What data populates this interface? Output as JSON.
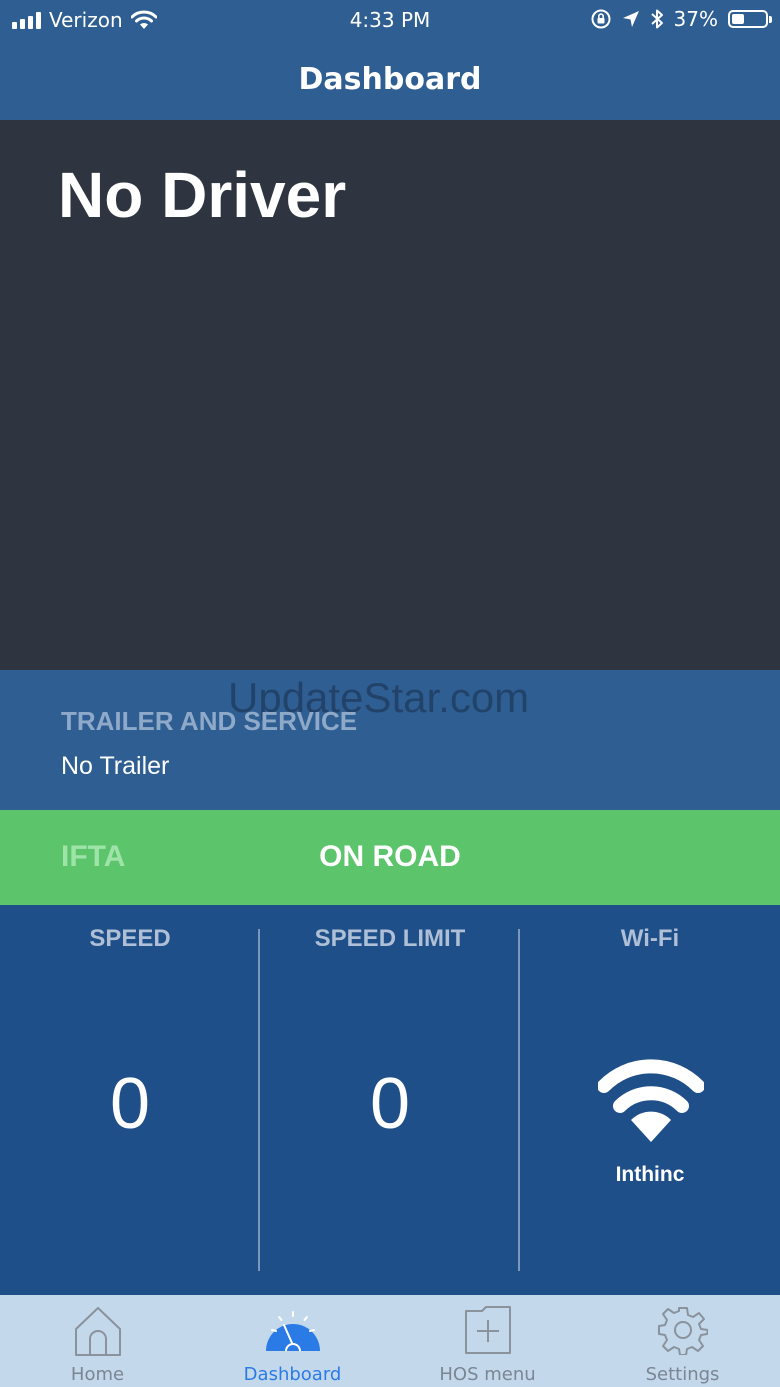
{
  "status_bar": {
    "carrier": "Verizon",
    "time": "4:33 PM",
    "battery": "37%"
  },
  "header": {
    "title": "Dashboard"
  },
  "driver": {
    "name": "No Driver"
  },
  "watermark": "UpdateStar.com",
  "trailer": {
    "label": "TRAILER AND SERVICE",
    "value": "No Trailer"
  },
  "ifta": {
    "label": "IFTA",
    "status": "ON ROAD"
  },
  "metrics": {
    "speed": {
      "label": "SPEED",
      "value": "0"
    },
    "speed_limit": {
      "label": "SPEED LIMIT",
      "value": "0"
    },
    "wifi": {
      "label": "Wi-Fi",
      "network": "Inthinc",
      "icon": "wifi-icon"
    }
  },
  "tabs": [
    {
      "label": "Home",
      "icon": "home-icon",
      "active": false
    },
    {
      "label": "Dashboard",
      "icon": "speedometer-icon",
      "active": true
    },
    {
      "label": "HOS menu",
      "icon": "add-folder-icon",
      "active": false
    },
    {
      "label": "Settings",
      "icon": "gear-icon",
      "active": false
    }
  ],
  "colors": {
    "header": "#2f5e93",
    "driver_panel": "#2f3540",
    "on_road": "#5cc46b",
    "metrics_panel": "#1f4f88",
    "tabbar": "#c4d8ec",
    "active_tab": "#2b7be6"
  }
}
